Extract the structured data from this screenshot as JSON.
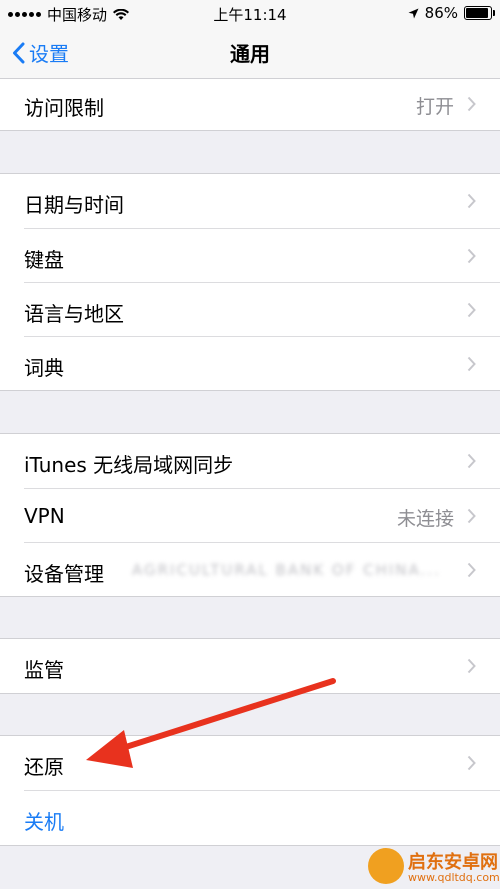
{
  "status": {
    "carrier": "中国移动",
    "time": "上午11:14",
    "battery": "86%"
  },
  "nav": {
    "back_label": "设置",
    "title": "通用"
  },
  "groups": {
    "restrictions": {
      "label": "访问限制",
      "value": "打开"
    },
    "date_time": {
      "label": "日期与时间"
    },
    "keyboard": {
      "label": "键盘"
    },
    "language_region": {
      "label": "语言与地区"
    },
    "dictionary": {
      "label": "词典"
    },
    "itunes_sync": {
      "label": "iTunes 无线局域网同步"
    },
    "vpn": {
      "label": "VPN",
      "value": "未连接"
    },
    "device_management": {
      "label": "设备管理",
      "value": "AGRICULTURAL BANK OF CHINA..."
    },
    "supervision": {
      "label": "监管"
    },
    "reset": {
      "label": "还原"
    },
    "shutdown": {
      "label": "关机"
    }
  },
  "watermark": {
    "name": "启东安卓网",
    "url": "www.qdltdq.com"
  },
  "colors": {
    "accent": "#1a7cf5",
    "arrow": "#e8321e"
  }
}
